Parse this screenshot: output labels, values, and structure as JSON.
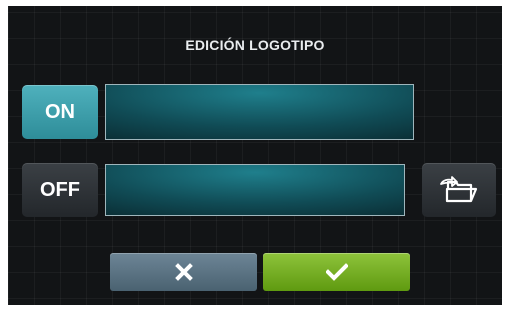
{
  "header": {
    "title": "EDICIÓN LOGOTIPO"
  },
  "logo_on": {
    "toggle_label": "ON",
    "field_value": ""
  },
  "logo_off": {
    "toggle_label": "OFF",
    "field_value": "",
    "browse_icon": "folder-open-icon"
  },
  "actions": {
    "cancel_icon": "close-icon",
    "confirm_icon": "check-icon"
  },
  "colors": {
    "on_accent": "#3fa3af",
    "confirm": "#7ab32a",
    "cancel": "#5b7484",
    "field": "#0f4c56",
    "background": "#121416"
  }
}
